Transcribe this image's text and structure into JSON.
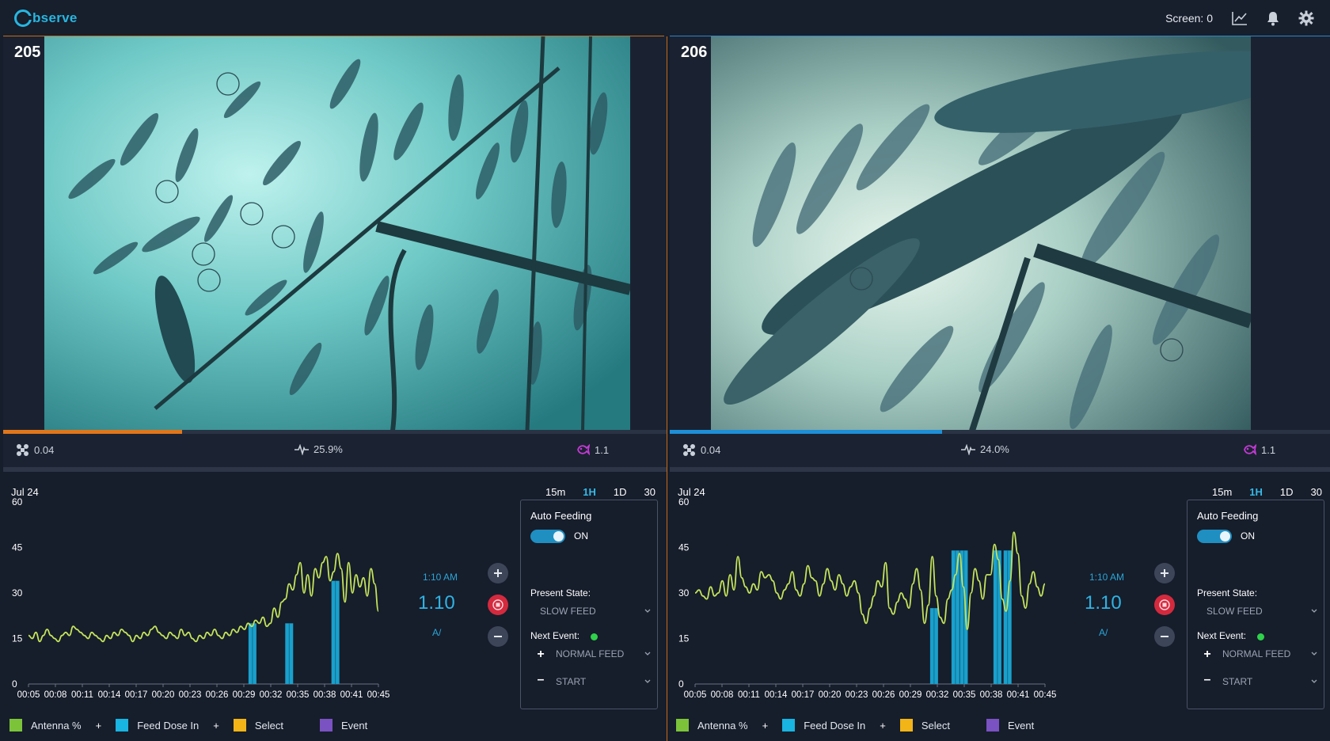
{
  "app": {
    "name": "bserve"
  },
  "header": {
    "screen_label": "Screen: 0",
    "icons": [
      "trend-icon",
      "bell-icon",
      "gear-icon"
    ]
  },
  "colors": {
    "accent": "#27b6e0",
    "orange": "#c86a16",
    "blue": "#2a86c8",
    "antenna_line": "#c4e35a",
    "feed_bar": "#1aa0cc",
    "record": "#d42a3e",
    "legend_antenna": "#7cc33a",
    "legend_feed": "#18b4e2",
    "legend_select": "#f2b417",
    "legend_event": "#7a52c2"
  },
  "panels": [
    {
      "camera_id": "205",
      "progress": 0.27,
      "progress_color": "#e0761a",
      "stats": {
        "left": "0.04",
        "center": "25.9%",
        "right": "1.1"
      },
      "chart": {
        "date": "Jul 24",
        "ranges": [
          {
            "label": "15m"
          },
          {
            "label": "1H"
          },
          {
            "label": "1D"
          },
          {
            "label": "30"
          }
        ],
        "active_range": "1H",
        "readout": {
          "time": "1:10 AM",
          "value": "1.10",
          "unit": "A/"
        },
        "auto_feeding": {
          "title": "Auto Feeding",
          "toggle": "ON",
          "present_state_label": "Present State:",
          "present_state": "SLOW FEED",
          "next_event_label": "Next Event:",
          "next_event": "NORMAL FEED",
          "start": "START"
        },
        "legend": {
          "antenna": "Antenna %",
          "feed": "Feed Dose In",
          "select": "Select",
          "event": "Event"
        }
      }
    },
    {
      "camera_id": "206",
      "progress": 0.41,
      "progress_color": "#1e8fd6",
      "stats": {
        "left": "0.04",
        "center": "24.0%",
        "right": "1.1"
      },
      "chart": {
        "date": "Jul 24",
        "ranges": [
          {
            "label": "15m"
          },
          {
            "label": "1H"
          },
          {
            "label": "1D"
          },
          {
            "label": "30"
          }
        ],
        "active_range": "1H",
        "readout": {
          "time": "1:10 AM",
          "value": "1.10",
          "unit": "A/"
        },
        "auto_feeding": {
          "title": "Auto Feeding",
          "toggle": "ON",
          "present_state_label": "Present State:",
          "present_state": "SLOW FEED",
          "next_event_label": "Next Event:",
          "next_event": "NORMAL FEED",
          "start": "START"
        },
        "legend": {
          "antenna": "Antenna %",
          "feed": "Feed Dose In",
          "select": "Select",
          "event": "Event"
        }
      }
    }
  ],
  "chart_data": [
    {
      "type": "line",
      "x": [
        "00:05",
        "00:08",
        "00:11",
        "00:14",
        "00:17",
        "00:20",
        "00:23",
        "00:26",
        "00:29",
        "00:32",
        "00:35",
        "00:38",
        "00:41",
        "00:45"
      ],
      "ylim": [
        0,
        60
      ],
      "yticks": [
        0,
        15,
        30,
        45,
        60
      ],
      "series": [
        {
          "name": "Antenna %",
          "values": [
            16,
            15,
            17,
            14,
            16,
            18,
            16,
            15,
            14,
            16,
            17,
            16,
            19,
            18,
            17,
            16,
            15,
            17,
            16,
            15,
            14,
            16,
            15,
            17,
            16,
            18,
            17,
            16,
            14,
            16,
            15,
            17,
            16,
            18,
            19,
            17,
            16,
            15,
            17,
            16,
            15,
            18,
            16,
            17,
            15,
            14,
            16,
            15,
            17,
            16,
            18,
            16,
            15,
            17,
            16,
            18,
            17,
            19,
            18,
            20,
            19,
            21,
            20,
            22,
            19,
            20,
            25,
            22,
            27,
            28,
            33,
            31,
            36,
            40,
            30,
            36,
            29,
            38,
            35,
            40,
            42,
            34,
            37,
            43,
            38,
            27,
            40,
            30,
            36,
            32,
            35,
            29,
            38,
            33,
            24
          ]
        },
        {
          "name": "Feed Dose In",
          "values": [
            [
              0.64,
              20
            ],
            [
              0.745,
              20
            ],
            [
              0.877,
              34
            ]
          ]
        }
      ]
    },
    {
      "type": "line",
      "x": [
        "00:05",
        "00:08",
        "00:11",
        "00:14",
        "00:17",
        "00:20",
        "00:23",
        "00:26",
        "00:29",
        "00:32",
        "00:35",
        "00:38",
        "00:41",
        "00:45"
      ],
      "ylim": [
        0,
        60
      ],
      "yticks": [
        0,
        15,
        30,
        45,
        60
      ],
      "series": [
        {
          "name": "Antenna %",
          "values": [
            30,
            31,
            29,
            28,
            32,
            29,
            30,
            34,
            29,
            36,
            31,
            42,
            35,
            32,
            30,
            33,
            31,
            37,
            35,
            36,
            34,
            30,
            28,
            31,
            33,
            37,
            31,
            29,
            33,
            39,
            35,
            34,
            29,
            33,
            38,
            34,
            31,
            36,
            33,
            29,
            32,
            34,
            30,
            23,
            20,
            25,
            29,
            34,
            32,
            40,
            25,
            23,
            27,
            30,
            28,
            25,
            33,
            38,
            31,
            20,
            26,
            42,
            29,
            22,
            20,
            28,
            31,
            36,
            43,
            32,
            18,
            30,
            38,
            34,
            28,
            36,
            36,
            46,
            41,
            28,
            24,
            34,
            50,
            43,
            29,
            25,
            33,
            37,
            32,
            29,
            33
          ]
        },
        {
          "name": "Feed Dose In",
          "values": [
            [
              0.683,
              25
            ],
            [
              0.744,
              44
            ],
            [
              0.768,
              44
            ],
            [
              0.864,
              44
            ],
            [
              0.893,
              44
            ]
          ]
        }
      ]
    }
  ]
}
